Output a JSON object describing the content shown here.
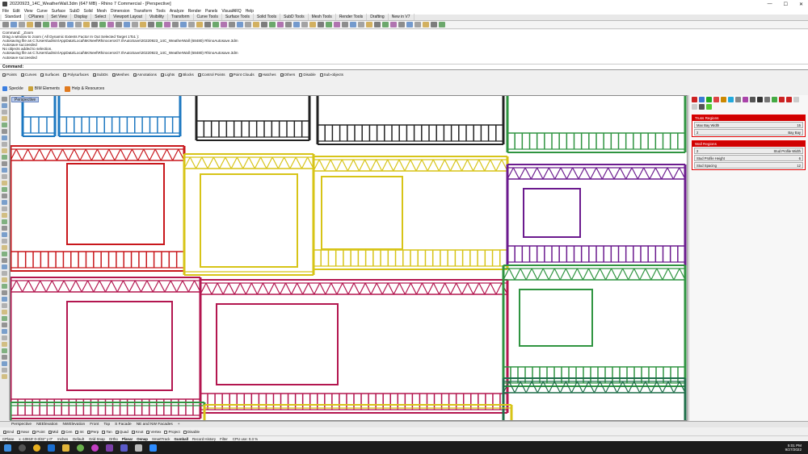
{
  "window": {
    "title": "20220923_14C_WeatherWall.3dm (647 MB) - Rhino 7 Commercial - [Perspective]"
  },
  "menu": [
    "File",
    "Edit",
    "View",
    "Curve",
    "Surface",
    "SubD",
    "Solid",
    "Mesh",
    "Dimension",
    "Transform",
    "Tools",
    "Analyze",
    "Render",
    "Panels",
    "VisualARQ",
    "Help"
  ],
  "tabs": [
    "Standard",
    "CPlanes",
    "Set View",
    "Display",
    "Select",
    "Viewport Layout",
    "Visibility",
    "Transform",
    "Curve Tools",
    "Surface Tools",
    "Solid Tools",
    "SubD Tools",
    "Mesh Tools",
    "Render Tools",
    "Drafting",
    "New in V7"
  ],
  "command_history": [
    "Command: _Zoom",
    "Drag a window to zoom ( All  Dynamic  Extents  Factor  In  Out  Selected  Target  1To1 ):",
    "Autosaving file as C:\\Users\\admin\\AppData\\Local\\McNeel\\Rhinoceros\\7.0\\AutoSave\\20220923_14C_WeatherWall (68480) RhinoAutosave.3dm",
    "Autosave succeeded",
    "No objects added to selection.",
    "Autosaving file as C:\\Users\\admin\\AppData\\Local\\McNeel\\Rhinoceros\\7.0\\AutoSave\\20220923_14C_WeatherWall (68480) RhinoAutosave.3dm",
    "Autosave succeeded"
  ],
  "command_prompt": "Command:",
  "selection_filter": [
    {
      "label": "Points",
      "checked": true
    },
    {
      "label": "Curves",
      "checked": true
    },
    {
      "label": "Surfaces",
      "checked": true
    },
    {
      "label": "Polysurfaces",
      "checked": true
    },
    {
      "label": "SubDs",
      "checked": true
    },
    {
      "label": "Meshes",
      "checked": true
    },
    {
      "label": "Annotations",
      "checked": true
    },
    {
      "label": "Lights",
      "checked": true
    },
    {
      "label": "Blocks",
      "checked": true
    },
    {
      "label": "Control Points",
      "checked": true
    },
    {
      "label": "Point Clouds",
      "checked": true
    },
    {
      "label": "Hatches",
      "checked": true
    },
    {
      "label": "Others",
      "checked": true
    },
    {
      "label": "Disable",
      "checked": false
    },
    {
      "label": "Sub-objects",
      "checked": false
    }
  ],
  "plugins": [
    "Speckle",
    "BIM Elements",
    "Help & Resources"
  ],
  "viewport": {
    "label": "Perspective"
  },
  "right_panel": {
    "groups": [
      {
        "header": "Truss Regions",
        "params": [
          {
            "label": "Max Bay Width",
            "value": "15"
          },
          {
            "label": "2",
            "value": "Bay Bay"
          }
        ]
      },
      {
        "header": "Wall Regions",
        "params": [
          {
            "label": "2",
            "value": "Stud Profile Width"
          },
          {
            "label": "Stud Profile Height",
            "value": "6"
          },
          {
            "label": "Stud Spacing",
            "value": "12"
          }
        ]
      }
    ]
  },
  "view_tabs": [
    "Perspective",
    "NEElevation",
    "NWElevation",
    "Front",
    "Top",
    "S Facade",
    "NE and NW Facades",
    "+"
  ],
  "osnaps": [
    {
      "label": "End",
      "checked": true
    },
    {
      "label": "Near",
      "checked": true
    },
    {
      "label": "Point",
      "checked": true
    },
    {
      "label": "Mid",
      "checked": true
    },
    {
      "label": "Cen",
      "checked": true
    },
    {
      "label": "Int",
      "checked": true
    },
    {
      "label": "Perp",
      "checked": true
    },
    {
      "label": "Tan",
      "checked": true
    },
    {
      "label": "Quad",
      "checked": true
    },
    {
      "label": "Knot",
      "checked": true
    },
    {
      "label": "Vertex",
      "checked": true
    },
    {
      "label": "Project",
      "checked": false
    },
    {
      "label": "Disable",
      "checked": false
    }
  ],
  "status": {
    "cplane": "CPlane",
    "coords": "x -10819' 0-3/32\"   y 0\"",
    "units": "Inches",
    "layer": "Default",
    "toggles": [
      "Grid Snap",
      "Ortho",
      "Planar",
      "Osnap",
      "SmartTrack",
      "Gumball",
      "Record History",
      "Filter"
    ],
    "cpu": "CPU use: 0.3 %"
  },
  "clock": {
    "time": "5:01 PM",
    "date": "9/27/2022"
  },
  "colors": {
    "blue_frame": "#1d78c1",
    "black_frame": "#222222",
    "red_frame": "#c8171c",
    "yellow_frame": "#d7c417",
    "purple_frame": "#6b1a8e",
    "green_frame": "#2f9440",
    "dark_green_frame": "#1f6e4a",
    "magenta_frame": "#b3164f",
    "panel_red": "#d00000"
  }
}
